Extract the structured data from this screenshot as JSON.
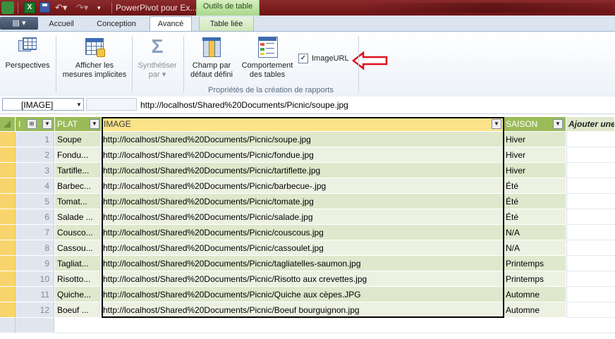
{
  "titlebar": {
    "window_title": "PowerPivot pour Ex...",
    "context_tab_group": "Outils de table",
    "excel_letter": "X"
  },
  "tabs": {
    "accueil": "Accueil",
    "conception": "Conception",
    "avance": "Avancé",
    "table_liee": "Table liée"
  },
  "ribbon": {
    "perspectives": "Perspectives",
    "implicit_line1": "Afficher les",
    "implicit_line2": "mesures implicites",
    "synth_line1": "Synthétiser",
    "synth_line2": "par",
    "champ_line1": "Champ par",
    "champ_line2": "défaut défini",
    "comport_line1": "Comportement",
    "comport_line2": "des tables",
    "imageurl_label": "ImageURL",
    "imageurl_checked": true,
    "group_label": "Propriétés de la création de rapports"
  },
  "formula_bar": {
    "namebox": "[IMAGE]",
    "value": "http://localhost/Shared%20Documents/Picnic/soupe.jpg"
  },
  "columns": {
    "plat": "PLAT",
    "image": "IMAGE",
    "saison": "SAISON",
    "add": "Ajouter une colonne"
  },
  "rows": [
    {
      "n": "1",
      "plat": "Soupe",
      "image": "http://localhost/Shared%20Documents/Picnic/soupe.jpg",
      "saison": "Hiver"
    },
    {
      "n": "2",
      "plat": "Fondu...",
      "image": "http://localhost/Shared%20Documents/Picnic/fondue.jpg",
      "saison": "Hiver"
    },
    {
      "n": "3",
      "plat": "Tartifle...",
      "image": "http://localhost/Shared%20Documents/Picnic/tartiflette.jpg",
      "saison": "Hiver"
    },
    {
      "n": "4",
      "plat": "Barbec...",
      "image": "http://localhost/Shared%20Documents/Picnic/barbecue-.jpg",
      "saison": "Été"
    },
    {
      "n": "5",
      "plat": "Tomat...",
      "image": "http://localhost/Shared%20Documents/Picnic/tomate.jpg",
      "saison": "Été"
    },
    {
      "n": "6",
      "plat": "Salade ...",
      "image": "http://localhost/Shared%20Documents/Picnic/salade.jpg",
      "saison": "Été"
    },
    {
      "n": "7",
      "plat": "Cousco...",
      "image": "http://localhost/Shared%20Documents/Picnic/couscous.jpg",
      "saison": "N/A"
    },
    {
      "n": "8",
      "plat": "Cassou...",
      "image": "http://localhost/Shared%20Documents/Picnic/cassoulet.jpg",
      "saison": "N/A"
    },
    {
      "n": "9",
      "plat": "Tagliat...",
      "image": "http://localhost/Shared%20Documents/Picnic/tagliatelles-saumon.jpg",
      "saison": "Printemps"
    },
    {
      "n": "10",
      "plat": "Risotto...",
      "image": "http://localhost/Shared%20Documents/Picnic/Risotto aux crevettes.jpg",
      "saison": "Printemps"
    },
    {
      "n": "11",
      "plat": "Quiche...",
      "image": "http://localhost/Shared%20Documents/Picnic/Quiche aux cèpes.JPG",
      "saison": "Automne"
    },
    {
      "n": "12",
      "plat": "Boeuf ...",
      "image": "http://localhost/Shared%20Documents/Picnic/Boeuf bourguignon.jpg",
      "saison": "Automne"
    }
  ],
  "colors": {
    "title_bar": "#7a1c1e",
    "header_green": "#9bbb59",
    "image_header": "#fbe38a",
    "row_green_dark": "#dfe8cc",
    "row_green_light": "#ecf1e2",
    "annotation_red": "#e0101a"
  }
}
